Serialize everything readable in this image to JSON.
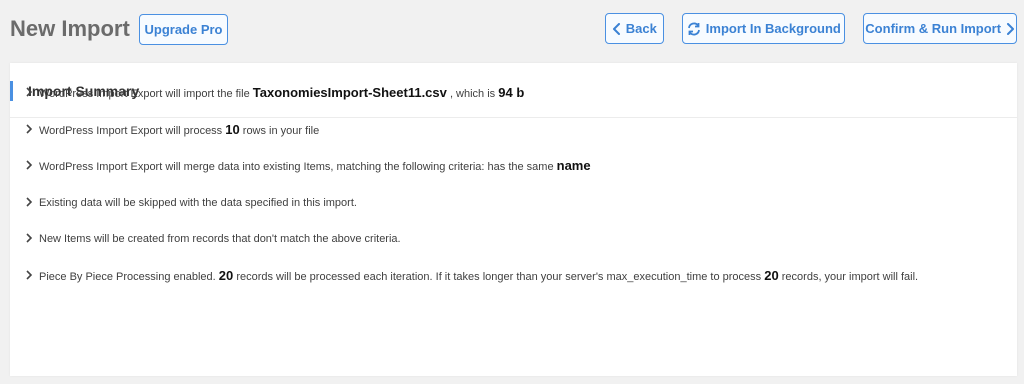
{
  "header": {
    "title": "New Import",
    "upgrade_label": "Upgrade Pro",
    "back_label": "Back",
    "background_label": "Import In Background",
    "confirm_label": "Confirm & Run Import"
  },
  "summary": {
    "title": "Import Summary",
    "line1": {
      "prefix": "WordPress Import Export will import the file",
      "filename": "TaxonomiesImport-Sheet11.csv",
      "middle": ", which is",
      "size": "94 b"
    },
    "line2": {
      "prefix": "WordPress Import Export will process",
      "count": "10",
      "suffix": "rows in your file"
    },
    "line3": {
      "prefix": "WordPress Import Export will merge data into existing Items, matching the following criteria: has the same",
      "field": "name"
    },
    "line4": "Existing data will be skipped with the data specified in this import.",
    "line5": "New Items will be created from records that don't match the above criteria.",
    "line6": {
      "prefix": "Piece By Piece Processing enabled.",
      "count1": "20",
      "middle": "records will be processed each iteration. If it takes longer than your server's max_execution_time to process",
      "count2": "20",
      "suffix": "records, your import will fail."
    }
  },
  "colors": {
    "accent": "#4a90e2",
    "background": "#f1f1f1"
  }
}
